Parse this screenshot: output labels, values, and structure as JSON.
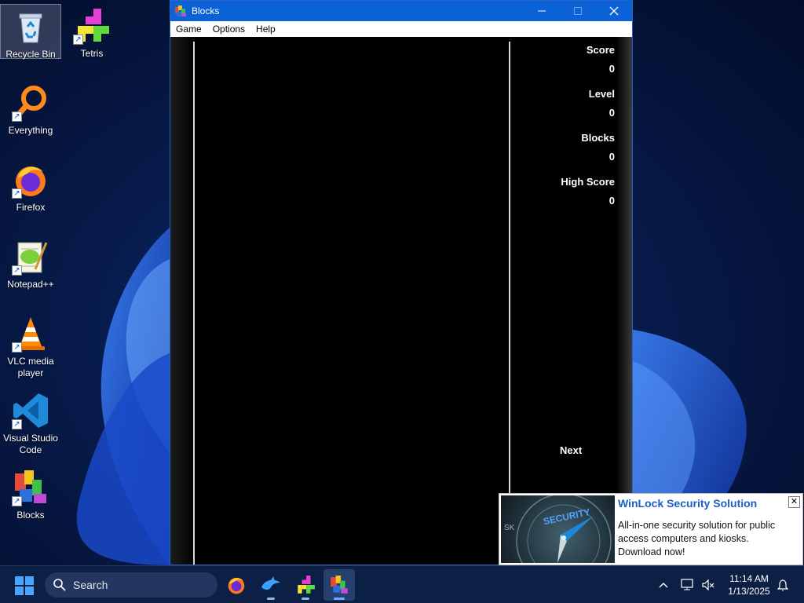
{
  "desktop": {
    "icons": [
      {
        "label": "Recycle Bin"
      },
      {
        "label": "Tetris"
      },
      {
        "label": "Everything"
      },
      {
        "label": "Firefox"
      },
      {
        "label": "Notepad++"
      },
      {
        "label": "VLC media player"
      },
      {
        "label": "Visual Studio Code"
      },
      {
        "label": "Blocks"
      }
    ]
  },
  "window": {
    "title": "Blocks",
    "menu": [
      "Game",
      "Options",
      "Help"
    ],
    "stats": [
      {
        "label": "Score",
        "value": "0"
      },
      {
        "label": "Level",
        "value": "0"
      },
      {
        "label": "Blocks",
        "value": "0"
      },
      {
        "label": "High Score",
        "value": "0"
      }
    ],
    "next_label": "Next"
  },
  "notification": {
    "title": "WinLock Security Solution",
    "body": "All-in-one security solution for public access computers and kiosks. Download now!",
    "image_text": "SECURITY",
    "image_text_partial": "SK"
  },
  "taskbar": {
    "search_label": "Search",
    "time": "11:14 AM",
    "date": "1/13/2025"
  },
  "colors": {
    "accent": "#0a62d6",
    "toast_title": "#1a5fc9",
    "taskbar": "#0c1f45"
  }
}
